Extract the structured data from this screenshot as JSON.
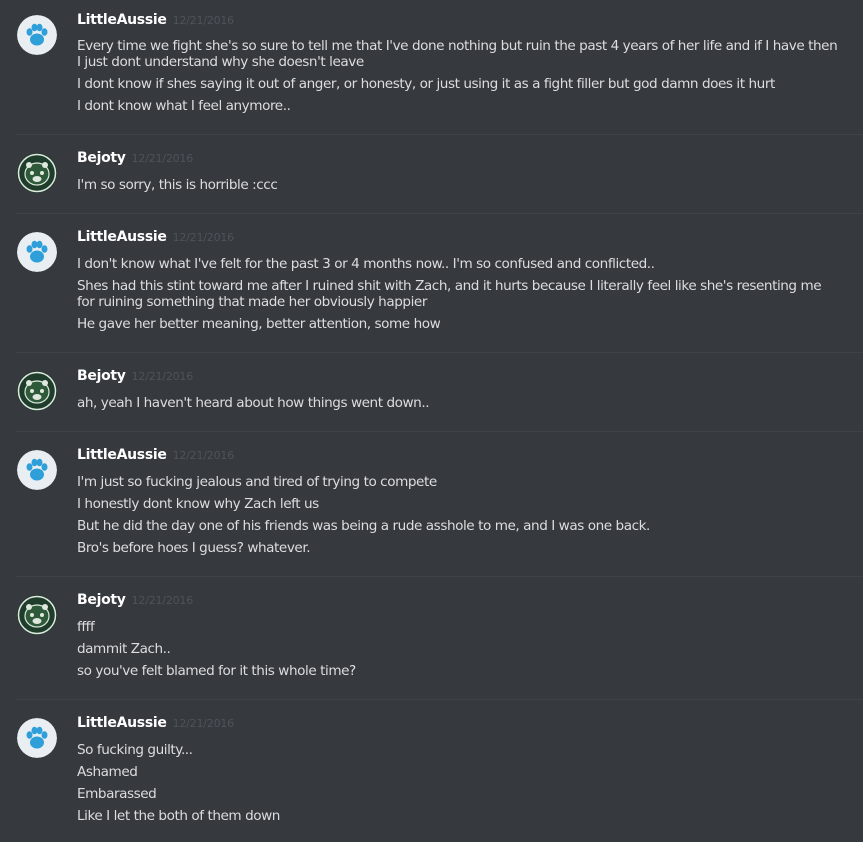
{
  "chat": {
    "messages": [
      {
        "author": "LittleAussie",
        "avatar": "paw-icon",
        "timestamp": "12/21/2016",
        "lines": [
          "Every time we fight she's so sure to tell me that I've done nothing but ruin the past 4 years of her life and if I have then",
          "I just dont understand why she doesn't leave",
          "I dont know if shes saying it out of anger, or honesty, or just using it as a fight filler but god damn does it hurt",
          "I dont know what I feel anymore.."
        ]
      },
      {
        "author": "Bejoty",
        "avatar": "creature-icon",
        "timestamp": "12/21/2016",
        "lines": [
          "I'm so sorry, this is horrible :ccc"
        ]
      },
      {
        "author": "LittleAussie",
        "avatar": "paw-icon",
        "timestamp": "12/21/2016",
        "lines": [
          "I don't know what I've felt for the past 3 or 4 months now.. I'm so confused and conflicted..",
          "Shes had this stint toward me after I ruined shit with Zach, and it hurts because I literally feel like she's resenting me",
          "for ruining something that made her obviously happier",
          "He gave her better meaning, better attention, some how"
        ]
      },
      {
        "author": "Bejoty",
        "avatar": "creature-icon",
        "timestamp": "12/21/2016",
        "lines": [
          "ah, yeah I haven't heard about how things went down.."
        ]
      },
      {
        "author": "LittleAussie",
        "avatar": "paw-icon",
        "timestamp": "12/21/2016",
        "lines": [
          "I'm just so fucking jealous and tired of trying to compete",
          "I honestly dont know why Zach left us",
          "But he did the day one of his friends was being a rude asshole to me, and I was one back.",
          "Bro's before hoes I guess? whatever."
        ]
      },
      {
        "author": "Bejoty",
        "avatar": "creature-icon",
        "timestamp": "12/21/2016",
        "lines": [
          "ffff",
          "dammit Zach..",
          "so you've felt blamed for it this whole time?"
        ]
      },
      {
        "author": "LittleAussie",
        "avatar": "paw-icon",
        "timestamp": "12/21/2016",
        "lines": [
          "So fucking guilty...",
          "Ashamed",
          "Embarassed",
          "Like I let the both of them down"
        ]
      }
    ]
  },
  "colors": {
    "background": "#36393e",
    "username": "#ffffff",
    "timestamp": "#4f535a",
    "message_text": "#dcddde",
    "divider": "#3f4247",
    "paw_avatar_bg": "#e8eef2",
    "paw_color": "#2e9fd8",
    "creature_avatar_bg": "#1e3d2a",
    "creature_color": "#dfe8df"
  }
}
